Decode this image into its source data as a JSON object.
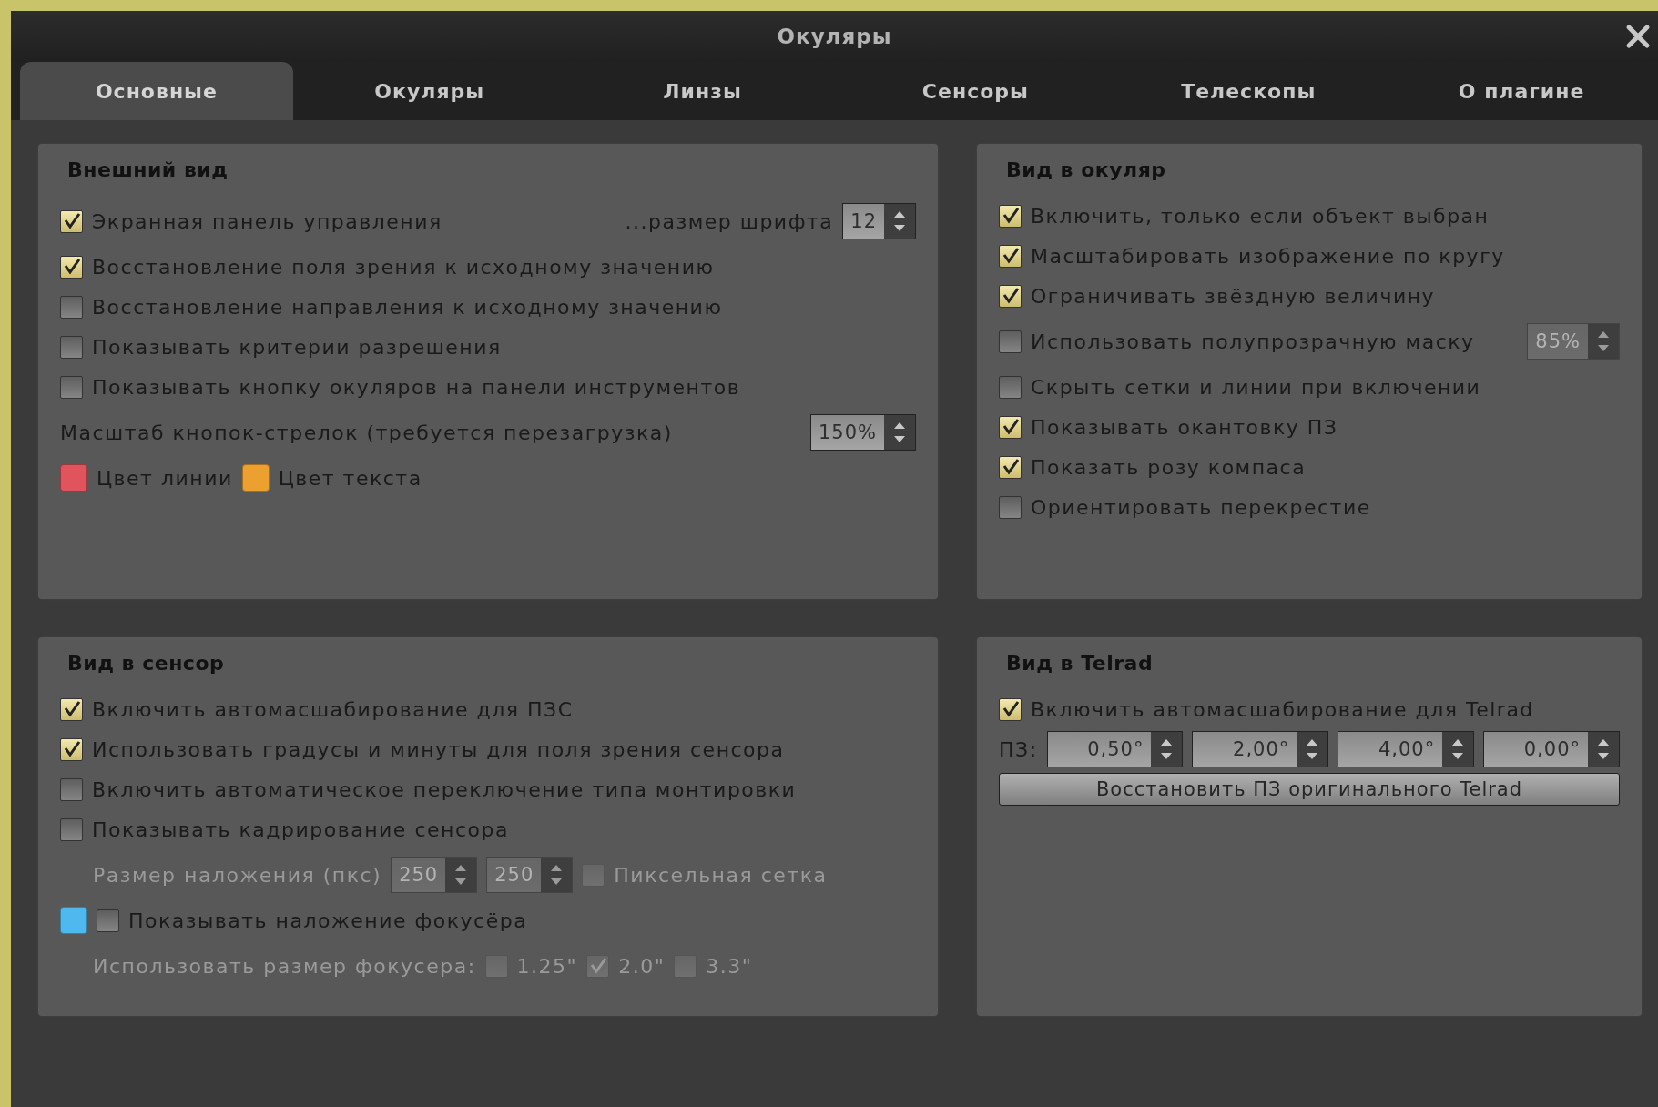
{
  "window": {
    "title": "Окуляры"
  },
  "tabs": [
    {
      "label": "Основные",
      "selected": true
    },
    {
      "label": "Окуляры",
      "selected": false
    },
    {
      "label": "Линзы",
      "selected": false
    },
    {
      "label": "Сенсоры",
      "selected": false
    },
    {
      "label": "Телескопы",
      "selected": false
    },
    {
      "label": "О плагине",
      "selected": false
    }
  ],
  "panels": [
    {
      "title": "Внешний вид",
      "rows": [
        {
          "kind": "line",
          "items": [
            {
              "kind": "checkbox",
              "label": "Экранная панель управления",
              "checked": true,
              "disabled": false
            }
          ],
          "trailing": [
            {
              "kind": "text",
              "text": "...размер шрифта",
              "disabled": false
            },
            {
              "kind": "spin",
              "value": "12",
              "disabled": false
            }
          ]
        },
        {
          "kind": "line",
          "items": [
            {
              "kind": "checkbox",
              "label": "Восстановление поля зрения к исходному значению",
              "checked": true,
              "disabled": false
            }
          ]
        },
        {
          "kind": "line",
          "items": [
            {
              "kind": "checkbox",
              "label": "Восстановление направления к исходному значению",
              "checked": false,
              "disabled": false
            }
          ]
        },
        {
          "kind": "line",
          "items": [
            {
              "kind": "checkbox",
              "label": "Показывать критерии разрешения",
              "checked": false,
              "disabled": false
            }
          ]
        },
        {
          "kind": "line",
          "items": [
            {
              "kind": "checkbox",
              "label": "Показывать кнопку окуляров на панели инструментов",
              "checked": false,
              "disabled": false
            }
          ]
        },
        {
          "kind": "line",
          "items": [
            {
              "kind": "text",
              "text": "Масштаб кнопок-стрелок (требуется перезагрузка)",
              "disabled": false
            }
          ],
          "trailing": [
            {
              "kind": "spin",
              "value": "150%",
              "disabled": false
            }
          ]
        },
        {
          "kind": "line",
          "items": [
            {
              "kind": "swatch",
              "color": "#e0545e"
            },
            {
              "kind": "text",
              "text": "Цвет линии",
              "disabled": false
            },
            {
              "kind": "swatch",
              "color": "#eba030"
            },
            {
              "kind": "text",
              "text": "Цвет текста",
              "disabled": false
            }
          ]
        }
      ]
    },
    {
      "title": "Вид в окуляр",
      "rows": [
        {
          "kind": "line",
          "items": [
            {
              "kind": "checkbox",
              "label": "Включить, только если объект выбран",
              "checked": true,
              "disabled": false
            }
          ]
        },
        {
          "kind": "line",
          "items": [
            {
              "kind": "checkbox",
              "label": "Масштабировать изображение по кругу",
              "checked": true,
              "disabled": false
            }
          ]
        },
        {
          "kind": "line",
          "items": [
            {
              "kind": "checkbox",
              "label": "Ограничивать звёздную величину",
              "checked": true,
              "disabled": false
            }
          ]
        },
        {
          "kind": "line",
          "items": [
            {
              "kind": "checkbox",
              "label": "Использовать полупрозрачную маску",
              "checked": false,
              "disabled": false
            }
          ],
          "trailing": [
            {
              "kind": "spin",
              "value": "85%",
              "disabled": true
            }
          ]
        },
        {
          "kind": "line",
          "items": [
            {
              "kind": "checkbox",
              "label": "Скрыть сетки и линии при включении",
              "checked": false,
              "disabled": false
            }
          ]
        },
        {
          "kind": "line",
          "items": [
            {
              "kind": "checkbox",
              "label": "Показывать окантовку ПЗ",
              "checked": true,
              "disabled": false
            }
          ]
        },
        {
          "kind": "line",
          "items": [
            {
              "kind": "checkbox",
              "label": "Показать розу компаса",
              "checked": true,
              "disabled": false
            }
          ]
        },
        {
          "kind": "line",
          "items": [
            {
              "kind": "checkbox",
              "label": "Ориентировать перекрестие",
              "checked": false,
              "disabled": false
            }
          ]
        }
      ]
    },
    {
      "title": "Вид в сенсор",
      "rows": [
        {
          "kind": "line",
          "items": [
            {
              "kind": "checkbox",
              "label": "Включить автомасшабирование для ПЗС",
              "checked": true,
              "disabled": false
            }
          ]
        },
        {
          "kind": "line",
          "items": [
            {
              "kind": "checkbox",
              "label": "Использовать градусы и минуты для поля зрения сенсора",
              "checked": true,
              "disabled": false
            }
          ]
        },
        {
          "kind": "line",
          "items": [
            {
              "kind": "checkbox",
              "label": "Включить автоматическое переключение типа монтировки",
              "checked": false,
              "disabled": false
            }
          ]
        },
        {
          "kind": "line",
          "items": [
            {
              "kind": "checkbox",
              "label": "Показывать кадрирование сенсора",
              "checked": false,
              "disabled": false
            }
          ]
        },
        {
          "kind": "sub",
          "items": [
            {
              "kind": "text",
              "text": "Размер наложения (пкс)",
              "disabled": true
            },
            {
              "kind": "spin",
              "value": "250",
              "disabled": true
            },
            {
              "kind": "spin",
              "value": "250",
              "disabled": true
            },
            {
              "kind": "checkbox",
              "label": "Пиксельная сетка",
              "checked": false,
              "disabled": true
            }
          ]
        },
        {
          "kind": "line",
          "items": [
            {
              "kind": "swatch",
              "color": "#4fb8ee"
            },
            {
              "kind": "checkbox",
              "label": "Показывать наложение фокусёра",
              "checked": false,
              "disabled": false
            }
          ]
        },
        {
          "kind": "sub",
          "items": [
            {
              "kind": "text",
              "text": "Использовать размер фокусера:",
              "disabled": true
            },
            {
              "kind": "checkbox",
              "label": "1.25\"",
              "checked": false,
              "disabled": true
            },
            {
              "kind": "checkbox",
              "label": "2.0\"",
              "checked": true,
              "disabled": true
            },
            {
              "kind": "checkbox",
              "label": "3.3\"",
              "checked": false,
              "disabled": true
            }
          ]
        }
      ]
    },
    {
      "title": "Вид в Telrad",
      "rows": [
        {
          "kind": "line",
          "items": [
            {
              "kind": "checkbox",
              "label": "Включить автомасшабирование для Telrad",
              "checked": true,
              "disabled": false
            }
          ]
        },
        {
          "kind": "fields",
          "items": [
            {
              "kind": "text",
              "text": "ПЗ:",
              "disabled": false
            },
            {
              "kind": "spin",
              "value": "0,50°",
              "disabled": false
            },
            {
              "kind": "spin",
              "value": "2,00°",
              "disabled": false
            },
            {
              "kind": "spin",
              "value": "4,00°",
              "disabled": false
            },
            {
              "kind": "spin",
              "value": "0,00°",
              "disabled": false
            }
          ]
        },
        {
          "kind": "line",
          "items": [
            {
              "kind": "button",
              "label": "Восстановить ПЗ оригинального Telrad"
            }
          ]
        }
      ]
    }
  ]
}
